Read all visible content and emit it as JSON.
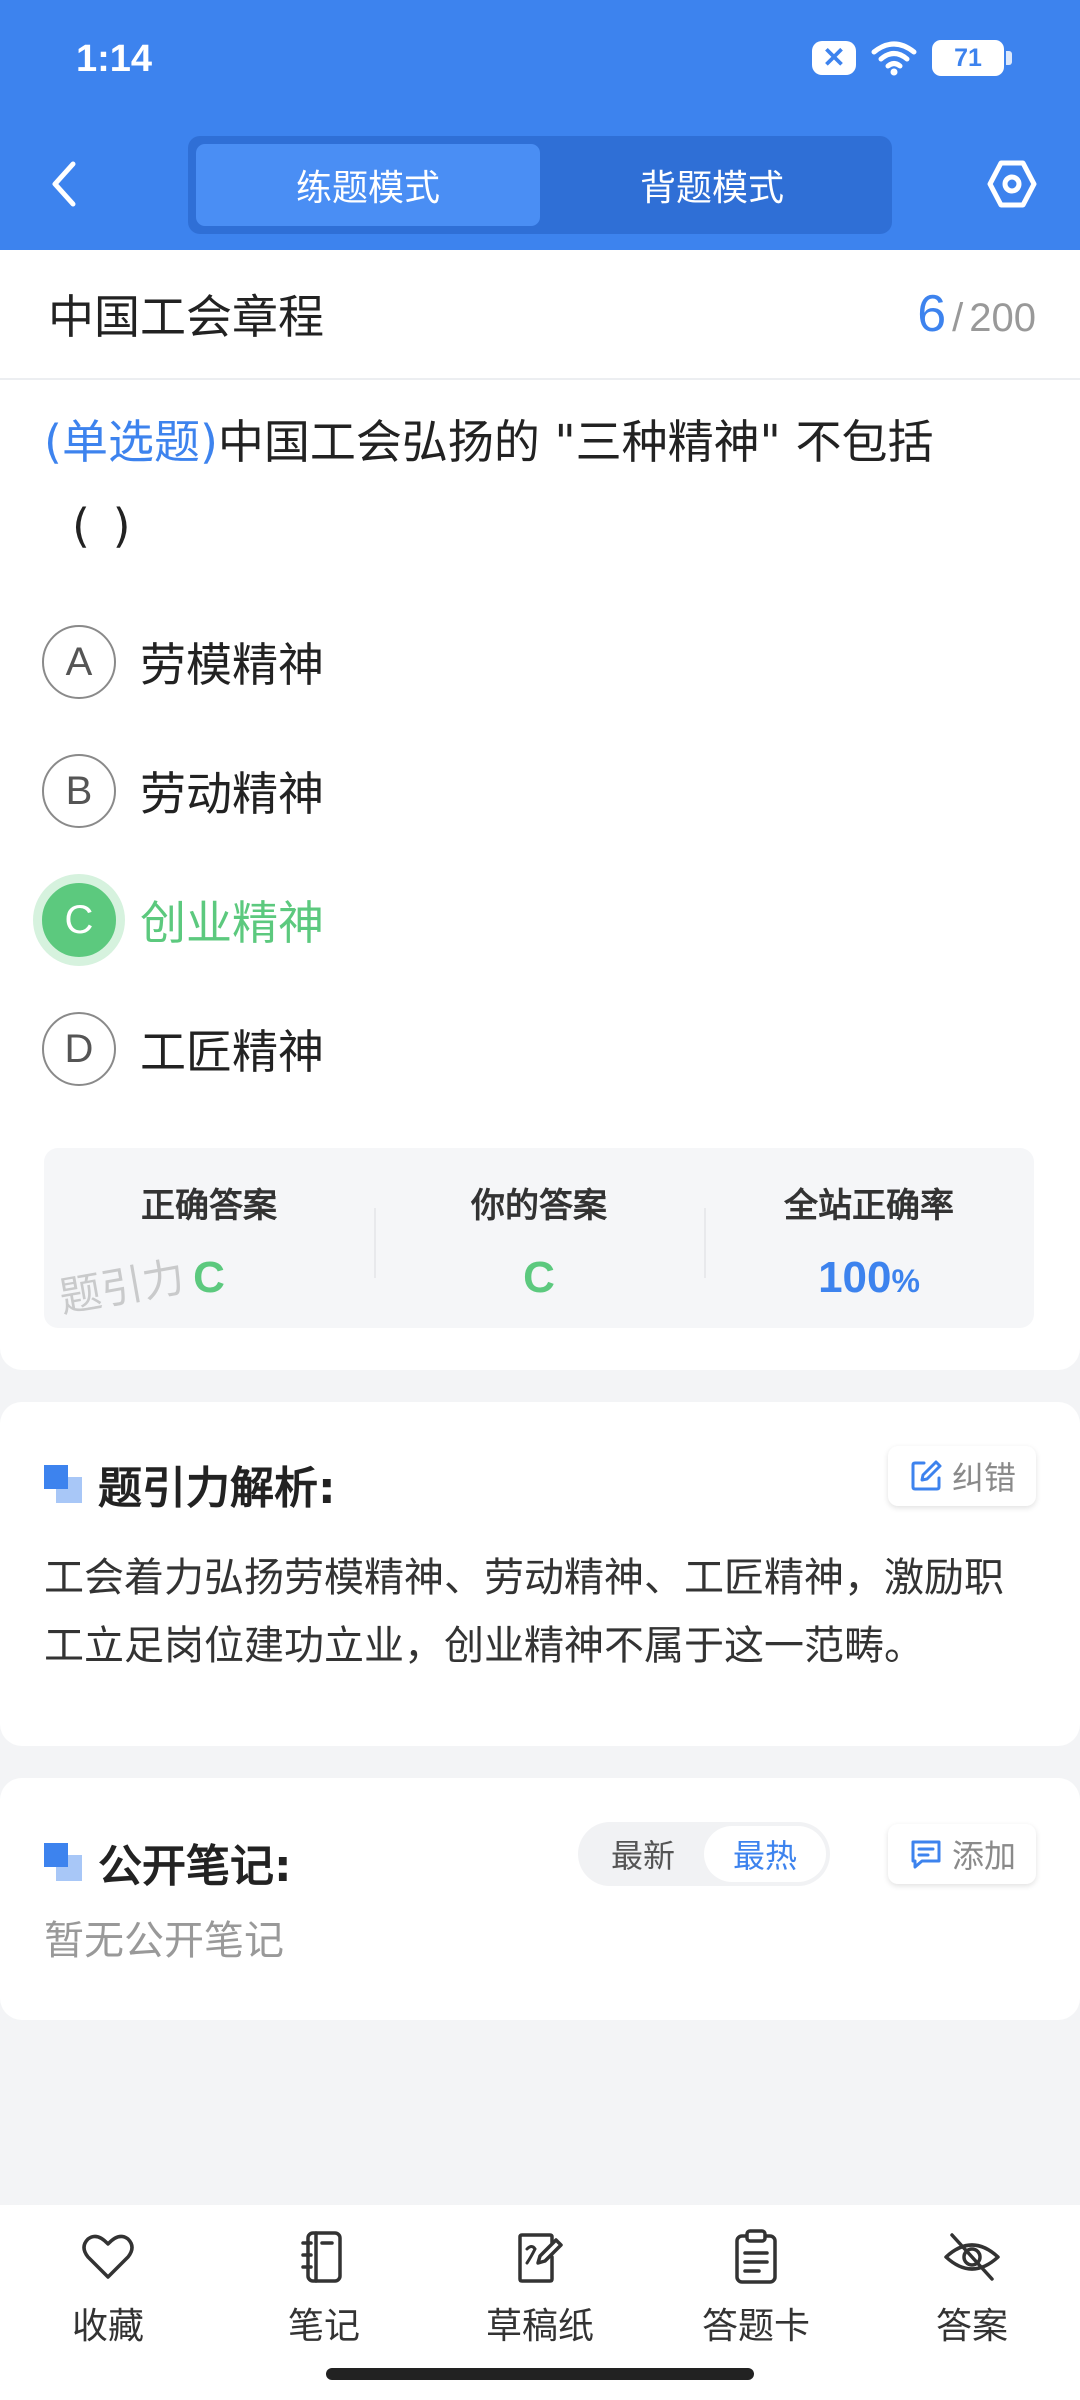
{
  "status_bar": {
    "time": "1:14",
    "battery": "71"
  },
  "header": {
    "modes": [
      {
        "label": "练题模式",
        "active": true
      },
      {
        "label": "背题模式",
        "active": false
      }
    ]
  },
  "chapter": {
    "title": "中国工会章程",
    "current": "6",
    "separator": "/",
    "total": "200"
  },
  "question": {
    "type": "(单选题)",
    "text": "中国工会弘扬的 \"三种精神\" 不包括",
    "blank": "(        )",
    "options": [
      {
        "letter": "A",
        "text": "劳模精神",
        "state": "normal"
      },
      {
        "letter": "B",
        "text": "劳动精神",
        "state": "normal"
      },
      {
        "letter": "C",
        "text": "创业精神",
        "state": "correct"
      },
      {
        "letter": "D",
        "text": "工匠精神",
        "state": "normal"
      }
    ]
  },
  "result": {
    "correct_label": "正确答案",
    "correct_value": "C",
    "yours_label": "你的答案",
    "yours_value": "C",
    "rate_label": "全站正确率",
    "rate_value": "100",
    "rate_unit": "%",
    "watermark": "题引力"
  },
  "analysis": {
    "title": "题引力解析:",
    "report_label": "纠错",
    "text": "工会着力弘扬劳模精神、劳动精神、工匠精神，激励职工立足岗位建功立业，创业精神不属于这一范畴。"
  },
  "notes": {
    "title": "公开笔记:",
    "sort_latest": "最新",
    "sort_hot": "最热",
    "add_label": "添加",
    "empty_text": "暂无公开笔记"
  },
  "bottom_nav": {
    "items": [
      {
        "label": "收藏",
        "icon": "heart-icon"
      },
      {
        "label": "笔记",
        "icon": "notebook-icon"
      },
      {
        "label": "草稿纸",
        "icon": "draft-icon"
      },
      {
        "label": "答题卡",
        "icon": "clipboard-icon"
      },
      {
        "label": "答案",
        "icon": "eye-off-icon"
      }
    ]
  },
  "colors": {
    "primary": "#3d83ee",
    "correct": "#5cc97e",
    "background": "#f3f4f6"
  }
}
